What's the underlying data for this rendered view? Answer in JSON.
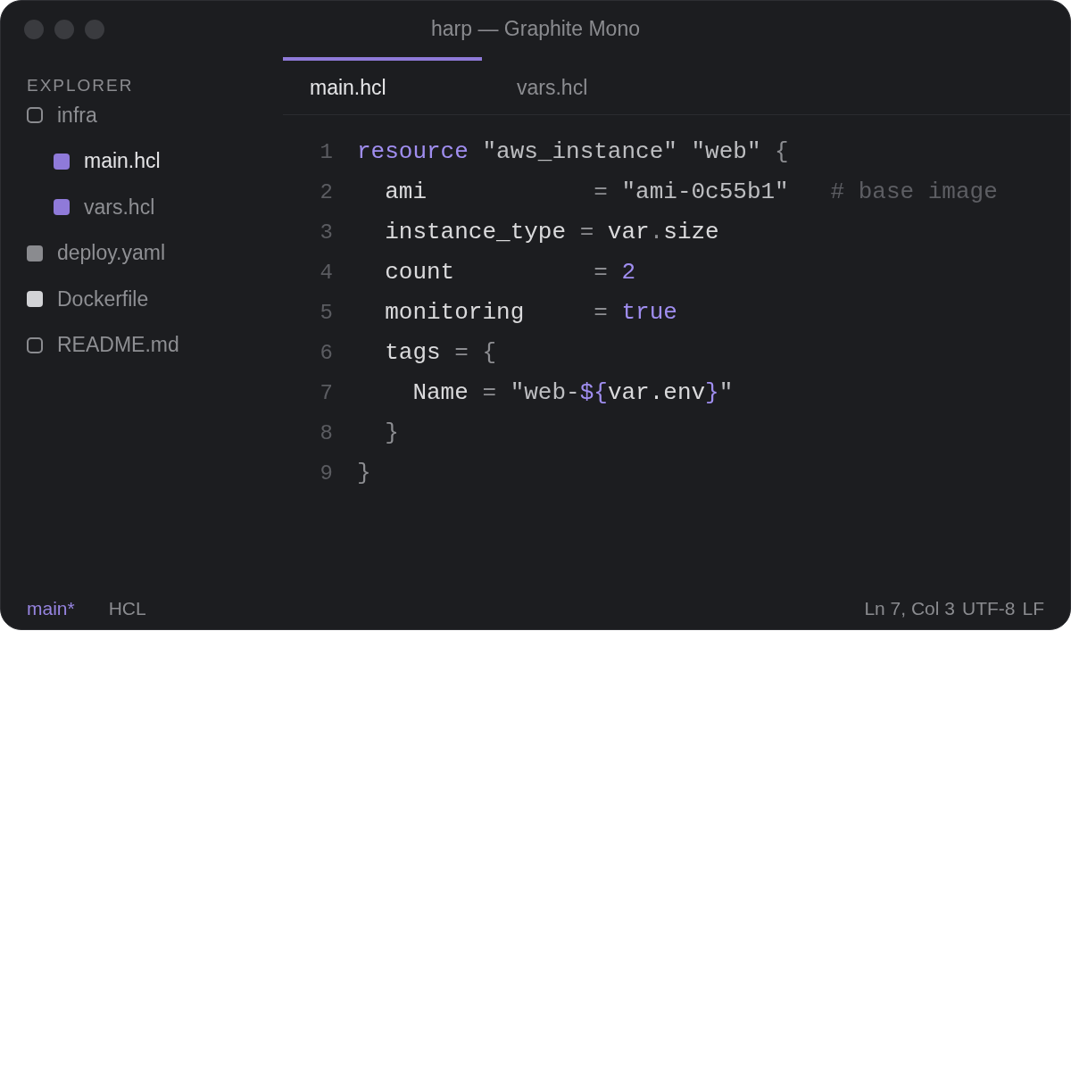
{
  "window": {
    "title": "harp — Graphite Mono"
  },
  "sidebar": {
    "heading": "EXPLORER",
    "items": [
      {
        "label": "infra",
        "kind": "outline",
        "color": "#8a8b8f",
        "selected": false,
        "children": [
          {
            "label": "main.hcl",
            "kind": "filled",
            "color": "#8f7ad9",
            "selected": true
          },
          {
            "label": "vars.hcl",
            "kind": "filled",
            "color": "#8f7ad9",
            "selected": false
          }
        ]
      },
      {
        "label": "deploy.yaml",
        "kind": "filled",
        "color": "#8a8b8f",
        "selected": false
      },
      {
        "label": "Dockerfile",
        "kind": "filled",
        "color": "#d2d3d6",
        "selected": false
      },
      {
        "label": "README.md",
        "kind": "outline",
        "color": "#8a8b8f",
        "selected": false
      }
    ]
  },
  "tabs": [
    {
      "label": "main.hcl",
      "selected": true
    },
    {
      "label": "vars.hcl",
      "selected": false
    }
  ],
  "editor": {
    "lines": [
      {
        "number": "1",
        "tokens": [
          {
            "text": "resource",
            "kind": "keyword"
          },
          {
            "text": " \"aws_instance\" \"web\"",
            "kind": "string"
          },
          {
            "text": " {",
            "kind": "punct"
          }
        ]
      },
      {
        "number": "2",
        "tokens": [
          {
            "text": "  ami            ",
            "kind": "ident"
          },
          {
            "text": "= ",
            "kind": "punct"
          },
          {
            "text": "\"ami-0c55b1\"",
            "kind": "string"
          },
          {
            "text": "   # base image",
            "kind": "comment"
          }
        ]
      },
      {
        "number": "3",
        "tokens": [
          {
            "text": "  instance_type ",
            "kind": "ident"
          },
          {
            "text": "= ",
            "kind": "punct"
          },
          {
            "text": "var",
            "kind": "ident"
          },
          {
            "text": ".",
            "kind": "punct"
          },
          {
            "text": "size",
            "kind": "ident"
          }
        ]
      },
      {
        "number": "4",
        "tokens": [
          {
            "text": "  count          ",
            "kind": "ident"
          },
          {
            "text": "= ",
            "kind": "punct"
          },
          {
            "text": "2",
            "kind": "number"
          }
        ]
      },
      {
        "number": "5",
        "tokens": [
          {
            "text": "  monitoring     ",
            "kind": "ident"
          },
          {
            "text": "= ",
            "kind": "punct"
          },
          {
            "text": "true",
            "kind": "keyword"
          }
        ]
      },
      {
        "number": "6",
        "tokens": [
          {
            "text": "  tags ",
            "kind": "ident"
          },
          {
            "text": "= {",
            "kind": "punct"
          }
        ]
      },
      {
        "number": "7",
        "tokens": [
          {
            "text": "    Name ",
            "kind": "ident"
          },
          {
            "text": "= ",
            "kind": "punct"
          },
          {
            "text": "\"web-",
            "kind": "string"
          },
          {
            "text": "${",
            "kind": "keyword"
          },
          {
            "text": "var.env",
            "kind": "ident"
          },
          {
            "text": "}",
            "kind": "keyword"
          },
          {
            "text": "\"",
            "kind": "string"
          }
        ]
      },
      {
        "number": "8",
        "tokens": [
          {
            "text": "  }",
            "kind": "punct"
          }
        ]
      },
      {
        "number": "9",
        "tokens": [
          {
            "text": "}",
            "kind": "punct"
          }
        ]
      }
    ]
  },
  "status_bar": {
    "branch": "main*",
    "language": "HCL",
    "position": "Ln 7, Col 3",
    "encoding": "UTF-8",
    "line_ending": "LF"
  }
}
